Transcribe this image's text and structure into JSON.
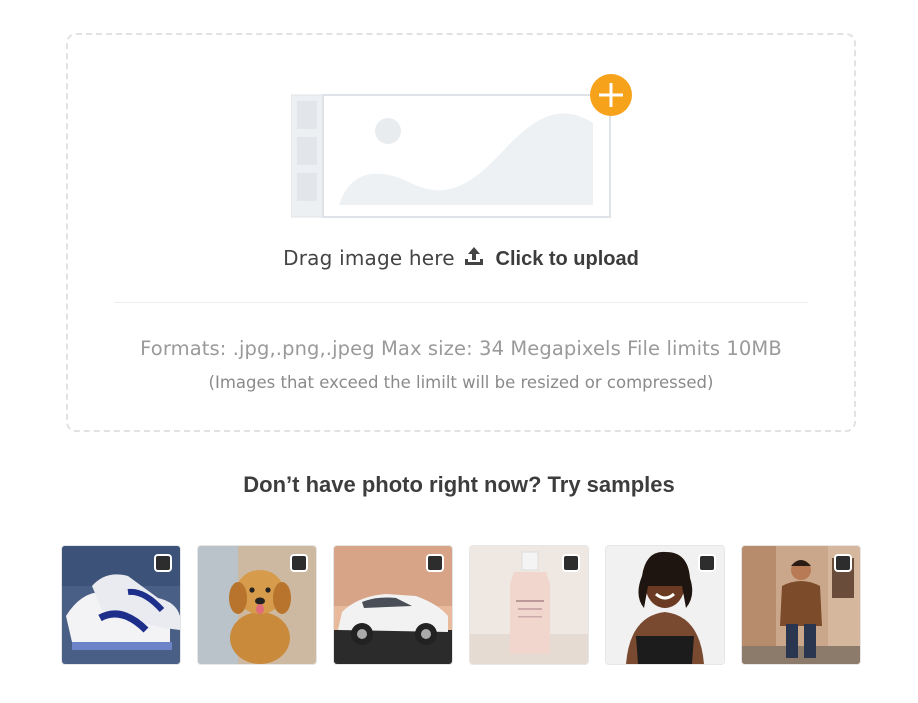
{
  "upload": {
    "drag_text": "Drag image here",
    "click_text": "Click to upload",
    "formats_text": "Formats: .jpg,.png,.jpeg Max size: 34 Megapixels File limits 10MB",
    "note_text": "(Images that exceed the limilt will be resized or compressed)",
    "accent_color": "#f7a21b"
  },
  "samples": {
    "title": "Don’t have photo right now? Try samples",
    "items": [
      {
        "subject": "white sneakers with blue swoosh"
      },
      {
        "subject": "golden retriever puppy"
      },
      {
        "subject": "white sedan car"
      },
      {
        "subject": "pink cosmetic bottle"
      },
      {
        "subject": "woman in black top"
      },
      {
        "subject": "man in brown jacket on street"
      }
    ]
  }
}
